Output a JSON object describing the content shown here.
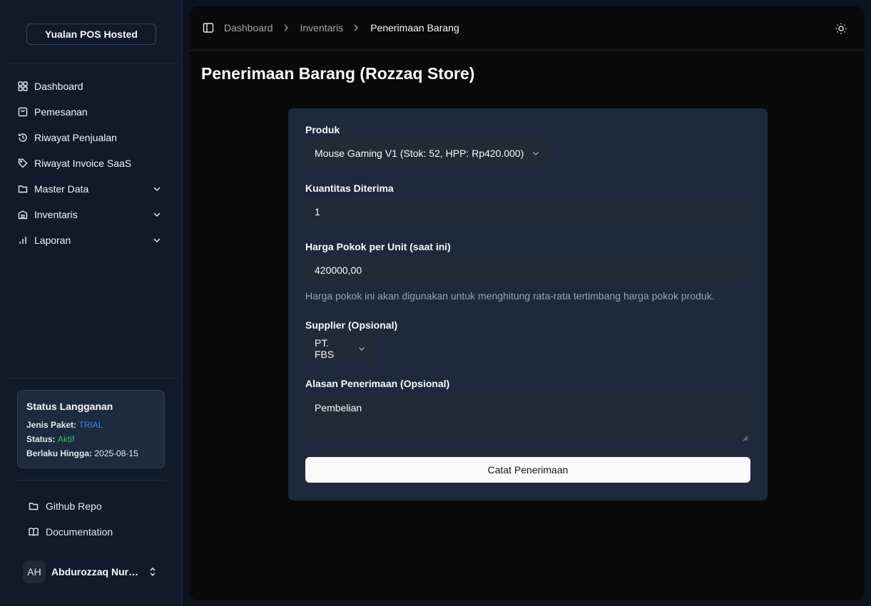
{
  "sidebar": {
    "brand": "Yualan POS Hosted",
    "nav": [
      {
        "label": "Dashboard",
        "icon": "dashboard-grid-icon"
      },
      {
        "label": "Pemesanan",
        "icon": "shopping-bag-icon"
      },
      {
        "label": "Riwayat Penjualan",
        "icon": "history-icon"
      },
      {
        "label": "Riwayat Invoice SaaS",
        "icon": "tag-icon"
      },
      {
        "label": "Master Data",
        "icon": "folder-icon"
      },
      {
        "label": "Inventaris",
        "icon": "warehouse-icon"
      },
      {
        "label": "Laporan",
        "icon": "bar-chart-icon"
      }
    ],
    "subscription": {
      "title": "Status Langganan",
      "plan_label": "Jenis Paket:",
      "plan_value": "TRIAL",
      "status_label": "Status:",
      "status_value": "Aktif",
      "valid_label": "Berlaku Hingga:",
      "valid_value": "2025-08-15"
    },
    "footer_links": [
      {
        "label": "Github Repo",
        "icon": "folder-icon"
      },
      {
        "label": "Documentation",
        "icon": "book-open-icon"
      }
    ],
    "user": {
      "initials": "AH",
      "name": "Abdurozzaq Nurul Hadi"
    }
  },
  "breadcrumb": [
    "Dashboard",
    "Inventaris",
    "Penerimaan Barang"
  ],
  "page_title": "Penerimaan Barang (Rozzaq Store)",
  "form": {
    "product_label": "Produk",
    "product_value": "Mouse Gaming V1 (Stok: 52, HPP: Rp420.000)",
    "quantity_label": "Kuantitas Diterima",
    "quantity_value": "1",
    "cost_label": "Harga Pokok per Unit (saat ini)",
    "cost_value": "420000,00",
    "cost_hint": "Harga pokok ini akan digunakan untuk menghitung rata-rata tertimbang harga pokok produk.",
    "supplier_label": "Supplier (Opsional)",
    "supplier_value": "PT. FBS",
    "reason_label": "Alasan Penerimaan (Opsional)",
    "reason_value": "Pembelian",
    "submit_label": "Catat Penerimaan"
  },
  "colors": {
    "accent_blue": "#3b82f6",
    "active_green": "#22c55e",
    "card_bg": "#1e293b"
  }
}
